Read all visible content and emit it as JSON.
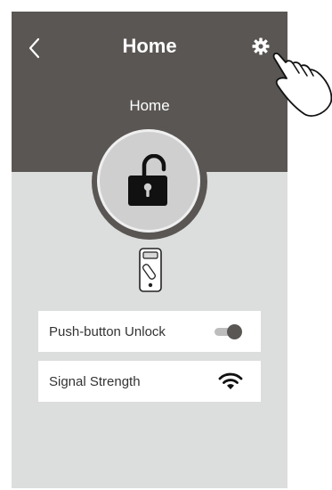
{
  "header": {
    "title": "Home",
    "back_icon": "chevron-left-icon",
    "settings_icon": "gear-icon"
  },
  "lock": {
    "name": "Home",
    "state_icon": "unlocked-padlock-icon"
  },
  "device": {
    "icon": "smart-lock-device-icon"
  },
  "settings_rows": [
    {
      "label": "Push-button Unlock",
      "control": "toggle",
      "state": "on"
    },
    {
      "label": "Signal Strength",
      "control": "wifi-icon"
    }
  ],
  "overlay": {
    "icon": "pointing-hand-icon"
  },
  "colors": {
    "header_bg": "#595654",
    "body_bg": "#dcdedd",
    "lock_button": "#cfcfcf"
  }
}
